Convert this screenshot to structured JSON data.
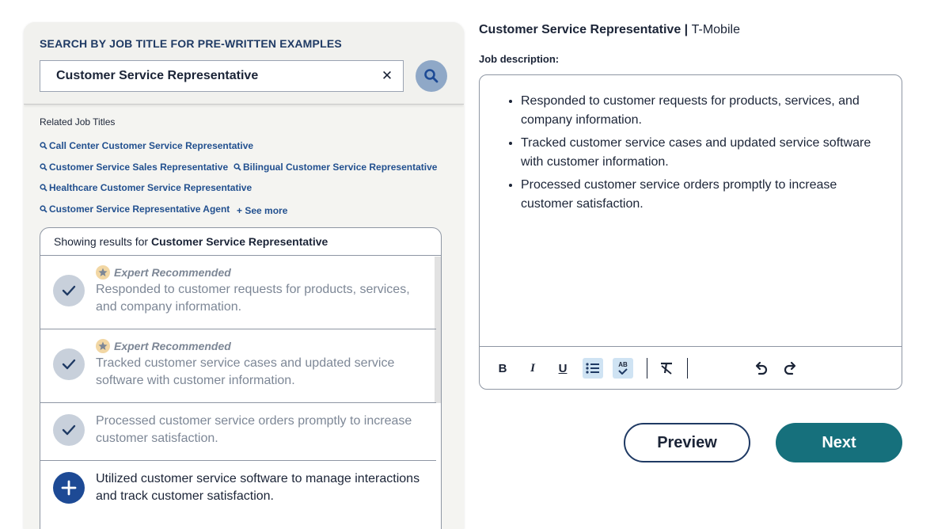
{
  "search": {
    "label": "SEARCH BY JOB TITLE FOR PRE-WRITTEN EXAMPLES",
    "value": "Customer Service Representative",
    "clear_symbol": "✕"
  },
  "related": {
    "title": "Related Job Titles",
    "links": [
      "Call Center Customer Service Representative",
      "Customer Service Sales Representative",
      "Bilingual Customer Service Representative",
      "Healthcare Customer Service Representative",
      "Customer Service Representative Agent"
    ],
    "see_more": "+ See more"
  },
  "results": {
    "prefix": "Showing results for ",
    "query": "Customer Service Representative",
    "badge_label": "Expert Recommended",
    "items": [
      {
        "text": "Responded to customer requests for products, services, and company information.",
        "expert": true,
        "added": true
      },
      {
        "text": "Tracked customer service cases and updated service software with customer information.",
        "expert": true,
        "added": true
      },
      {
        "text": "Processed customer service orders promptly to increase customer satisfaction.",
        "expert": false,
        "added": true
      },
      {
        "text": "Utilized customer service software to manage interactions and track customer satisfaction.",
        "expert": false,
        "added": false
      }
    ]
  },
  "job": {
    "title": "Customer Service Representative",
    "separator": " | ",
    "employer": "T-Mobile",
    "desc_label": "Job description:",
    "bullets": [
      "Responded to customer requests for products, services, and company information.",
      "Tracked customer service cases and updated service software with customer information.",
      "Processed customer service orders promptly to increase customer satisfaction."
    ]
  },
  "toolbar": {
    "bold": "B",
    "italic": "I",
    "underline": "U",
    "spellcheck": "AB"
  },
  "actions": {
    "preview": "Preview",
    "next": "Next"
  },
  "colors": {
    "accent_teal": "#16707c",
    "navy": "#1f3a64",
    "link_blue": "#22508f",
    "search_button": "#8fa8c7",
    "add_circle": "#1d4a95"
  },
  "icons": [
    "search-icon",
    "close-icon",
    "check-icon",
    "plus-icon",
    "star-icon",
    "bold-icon",
    "italic-icon",
    "underline-icon",
    "bullet-list-icon",
    "spellcheck-icon",
    "clear-format-icon",
    "undo-icon",
    "redo-icon"
  ]
}
